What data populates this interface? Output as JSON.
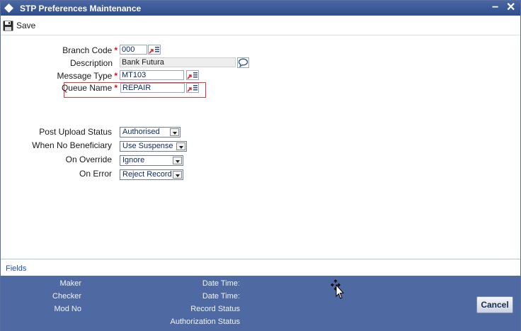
{
  "window": {
    "title": "STP Preferences Maintenance",
    "minimize_label": "−",
    "close_label": "✕"
  },
  "toolbar": {
    "save_label": "Save"
  },
  "form": {
    "branch_code": {
      "label": "Branch Code",
      "value": "000"
    },
    "description": {
      "label": "Description",
      "value": "Bank Futura"
    },
    "message_type": {
      "label": "Message Type",
      "value": "MT103"
    },
    "queue_name": {
      "label": "Queue Name",
      "value": "REPAIR"
    },
    "required_mark": "*",
    "post_upload_status": {
      "label": "Post Upload Status",
      "value": "Authorised"
    },
    "when_no_beneficiary": {
      "label": "When No Beneficiary",
      "value": "Use Suspense"
    },
    "on_override": {
      "label": "On Override",
      "value": "Ignore"
    },
    "on_error": {
      "label": "On Error",
      "value": "Reject Record"
    }
  },
  "fields_link": "Fields",
  "footer": {
    "maker": "Maker",
    "checker": "Checker",
    "mod_no": "Mod No",
    "date_time_1": "Date Time:",
    "date_time_2": "Date Time:",
    "record_status": "Record Status",
    "authorization_status": "Authorization Status",
    "cancel_label": "Cancel"
  },
  "colors": {
    "title_bar": "#3a5897",
    "footer": "#4f6aa3",
    "required": "#dd1111",
    "highlight_border": "#e23a3a"
  }
}
